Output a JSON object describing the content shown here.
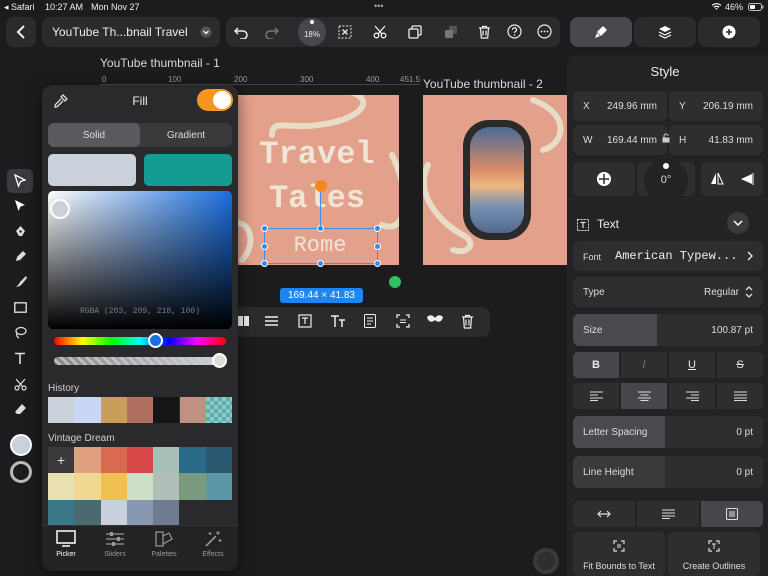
{
  "status_bar": {
    "back_app": "◂ Safari",
    "time": "10:27 AM",
    "date": "Mon Nov 27",
    "battery": "46%"
  },
  "toolbar": {
    "document_title": "YouTube Th...bnail Travel",
    "zoom": "18%"
  },
  "canvas": {
    "ruler_ticks": [
      "0",
      "100",
      "200",
      "300",
      "400",
      "451.5"
    ],
    "artboard_1_title": "YouTube thumbnail - 1",
    "artboard_2_title": "YouTube thumbnail - 2",
    "heading_line1": "Travel",
    "heading_line2": "Tales",
    "selected_text": "Rome",
    "selection_size": "169.44 × 41.83"
  },
  "fill_panel": {
    "title": "Fill",
    "tab_solid": "Solid",
    "tab_gradient": "Gradient",
    "rgba_readout": "RGBA (203, 209, 218, 100)",
    "history_label": "History",
    "palette_label": "Vintage Dream",
    "history_colors": [
      "#cbd1da",
      "#c8d8f4",
      "#c79e5a",
      "#b07060",
      "#151515",
      "#c09080"
    ],
    "palette_colors": [
      "#e0a080",
      "#d86a50",
      "#d84848",
      "#a8c0b8",
      "#2a6a88",
      "#2a5870",
      "#e8e0b0",
      "#f0d890",
      "#f0c050",
      "#d0e0c8",
      "#b0c0b8",
      "#7a9a80",
      "#5a98a8",
      "#3a7888",
      "#4a6a70",
      "#c8d0dc",
      "#8898b0",
      "#707a90"
    ],
    "tabs": [
      "Picker",
      "Sliders",
      "Palettes",
      "Effects"
    ]
  },
  "style_panel": {
    "title": "Style",
    "x_label": "X",
    "x_value": "249.96 mm",
    "y_label": "Y",
    "y_value": "206.19 mm",
    "w_label": "W",
    "w_value": "169.44 mm",
    "h_label": "H",
    "h_value": "41.83 mm",
    "rotation": "0°",
    "text_section": "Text",
    "font_label": "Font",
    "font_value": "American Typew...",
    "type_label": "Type",
    "type_value": "Regular",
    "size_label": "Size",
    "size_value": "100.87 pt",
    "bold": "B",
    "italic": "I",
    "underline": "U",
    "strike": "S",
    "letter_spacing_label": "Letter Spacing",
    "letter_spacing_value": "0 pt",
    "line_height_label": "Line Height",
    "line_height_value": "0 pt",
    "fit_bounds": "Fit Bounds to Text",
    "create_outlines": "Create Outlines"
  },
  "colors": {
    "accent": "#1e90ff",
    "artboard": "#e3a08a",
    "toggle": "#f5961e",
    "teal": "#149c94",
    "fill_current": "#cbd1da"
  }
}
